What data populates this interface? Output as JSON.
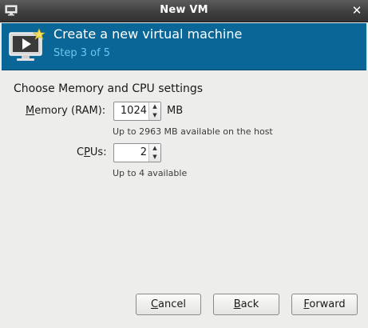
{
  "window": {
    "title": "New VM",
    "close_glyph": "✕"
  },
  "header": {
    "title": "Create a new virtual machine",
    "step": "Step 3 of 5",
    "icon": "virtual-machine-new-icon"
  },
  "main": {
    "section_title": "Choose Memory and CPU settings",
    "memory": {
      "label_mnemonic": "M",
      "label_rest": "emory (RAM):",
      "value": "1024",
      "unit": "MB",
      "hint": "Up to 2963 MB available on the host"
    },
    "cpus": {
      "label_pre": "C",
      "label_mnemonic": "P",
      "label_rest": "Us:",
      "value": "2",
      "hint": "Up to 4 available"
    },
    "spin_up_glyph": "▲",
    "spin_down_glyph": "▼"
  },
  "buttons": {
    "cancel": {
      "mnemonic": "C",
      "rest": "ancel"
    },
    "back": {
      "mnemonic": "B",
      "rest": "ack"
    },
    "forward": {
      "mnemonic": "F",
      "rest": "orward"
    }
  },
  "colors": {
    "banner": "#0a6697",
    "step_text": "#6fc6ee",
    "titlebar": "#3f3f3f"
  }
}
